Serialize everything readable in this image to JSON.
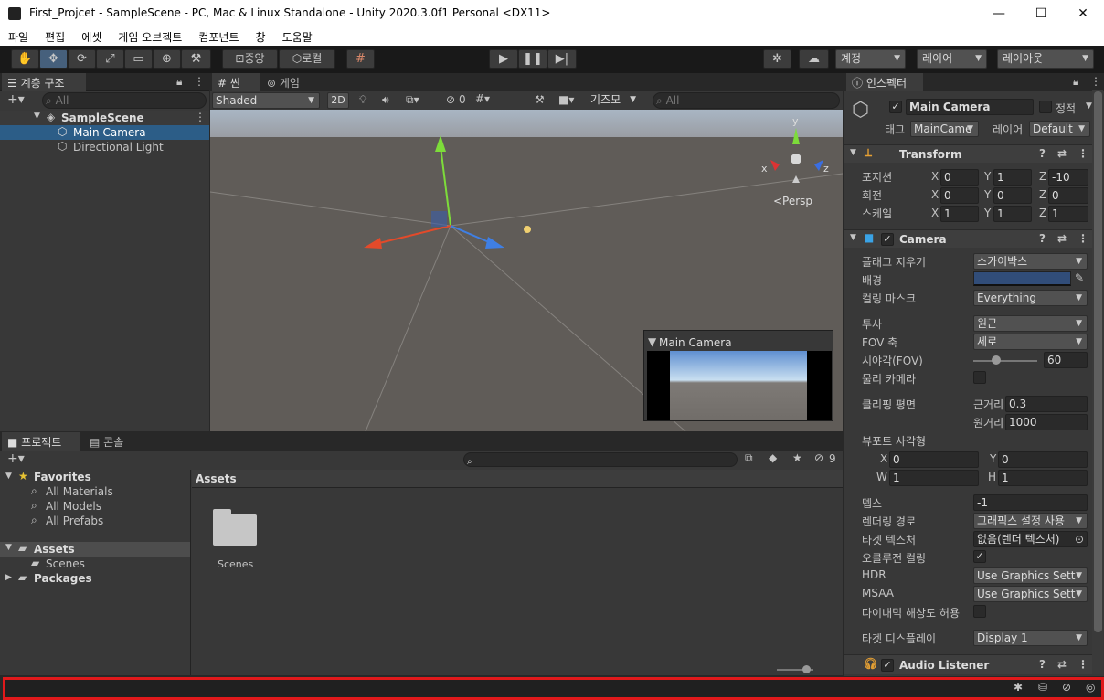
{
  "window": {
    "title": "First_Projcet - SampleScene - PC, Mac & Linux Standalone - Unity 2020.3.0f1 Personal <DX11>",
    "min": "—",
    "max": "☐",
    "close": "✕"
  },
  "menu": [
    "파일",
    "편집",
    "에셋",
    "게임 오브젝트",
    "컴포넌트",
    "창",
    "도움말"
  ],
  "toolbar": {
    "pivot": "중앙",
    "space": "로컬",
    "account": "계정",
    "layers": "레이어",
    "layout": "레이아웃"
  },
  "hierarchy": {
    "tab": "계층 구조",
    "search_placeholder": "All",
    "scene": "SampleScene",
    "items": [
      "Main Camera",
      "Directional Light"
    ]
  },
  "scene": {
    "tab_scene": "씬",
    "tab_game": "게임",
    "shading": "Shaded",
    "mode2d": "2D",
    "hidden_count": "0",
    "gizmos": "기즈모",
    "search_placeholder": "All",
    "persp": "<Persp",
    "preview_title": "Main Camera",
    "axis_x": "x",
    "axis_y": "y",
    "axis_z": "z"
  },
  "project": {
    "tab_project": "프로젝트",
    "tab_console": "콘솔",
    "favorites": "Favorites",
    "fav_items": [
      "All Materials",
      "All Models",
      "All Prefabs"
    ],
    "assets": "Assets",
    "asset_children": [
      "Scenes"
    ],
    "packages": "Packages",
    "breadcrumb": "Assets",
    "folder_name": "Scenes",
    "hidden_count": "9"
  },
  "inspector": {
    "tab": "인스펙터",
    "object_name": "Main Camera",
    "static_label": "정적",
    "tag_label": "태그",
    "tag_value": "MainCame",
    "layer_label": "레이어",
    "layer_value": "Default",
    "transform": {
      "title": "Transform",
      "rows": [
        {
          "label": "포지션",
          "x": "0",
          "y": "1",
          "z": "-10"
        },
        {
          "label": "회전",
          "x": "0",
          "y": "0",
          "z": "0"
        },
        {
          "label": "스케일",
          "x": "1",
          "y": "1",
          "z": "1"
        }
      ]
    },
    "camera": {
      "title": "Camera",
      "clear_flags_label": "플래그 지우기",
      "clear_flags": "스카이박스",
      "background_label": "배경",
      "culling_label": "컬링 마스크",
      "culling": "Everything",
      "projection_label": "투사",
      "projection": "원근",
      "fov_axis_label": "FOV 축",
      "fov_axis": "세로",
      "fov_label": "시야각(FOV)",
      "fov": "60",
      "physical_label": "물리 카메라",
      "clipping_label": "클리핑 평면",
      "near_label": "근거리",
      "near": "0.3",
      "far_label": "원거리",
      "far": "1000",
      "viewport_label": "뷰포트 사각형",
      "vx": "0",
      "vy": "0",
      "vw": "1",
      "vh": "1",
      "depth_label": "뎁스",
      "depth": "-1",
      "render_path_label": "렌더링 경로",
      "render_path": "그래픽스 설정 사용",
      "target_tex_label": "타겟 텍스처",
      "target_tex": "없음(렌더 텍스처)",
      "occlusion_label": "오클루전 컬링",
      "hdr_label": "HDR",
      "hdr": "Use Graphics Sett",
      "msaa_label": "MSAA",
      "msaa": "Use Graphics Sett",
      "dynres_label": "다이내믹 해상도 허용",
      "target_display_label": "타겟 디스플레이",
      "target_display": "Display 1"
    },
    "audio": {
      "title": "Audio Listener"
    }
  },
  "colors": {
    "accent": "#2c5d87",
    "status_highlight": "#e0191b",
    "camera_bg": "#314d79"
  }
}
